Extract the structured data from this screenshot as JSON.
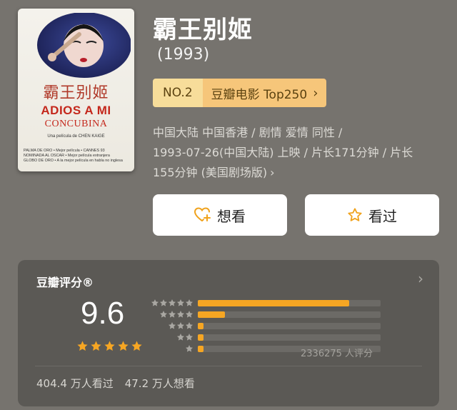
{
  "movie": {
    "title": "霸王别姬",
    "year": "(1993)",
    "rank_no": "NO.2",
    "rank_list": "豆瓣电影 Top250",
    "meta_line1": "中国大陆 中国香港 / 剧情 爱情 同性 /",
    "meta_line2": "1993-07-26(中国大陆) 上映 / 片长171分钟 / 片长",
    "meta_line3": "155分钟 (美国剧场版)"
  },
  "poster": {
    "cn_title": "霸王别姬",
    "en_title_1": "ADIOS A MI",
    "en_title_2": "CONCUBINA",
    "byline": "Una película de CHEN KAIGE",
    "credits_1": "PALMA DE ORO • Mejor película • CANNES 93",
    "credits_2": "NOMINADA AL OSCAR • Mejor película extranjera",
    "credits_3": "GLOBO DE ORO • A la mejor película en habla no inglesa"
  },
  "actions": {
    "want_label": "想看",
    "seen_label": "看过"
  },
  "rating": {
    "section_title": "豆瓣评分®",
    "score": "9.6",
    "score_stars": 5,
    "distribution": [
      {
        "stars": 5,
        "fraction": 0.83
      },
      {
        "stars": 4,
        "fraction": 0.15
      },
      {
        "stars": 3,
        "fraction": 0.02
      },
      {
        "stars": 2,
        "fraction": 0.01
      },
      {
        "stars": 1,
        "fraction": 0.01
      }
    ],
    "count_text": "2336275 人评分",
    "watched_text": "404.4 万人看过",
    "want_text": "47.2 万人想看"
  },
  "colors": {
    "accent_star": "#f6a623",
    "badge_light": "#f7dd9a",
    "badge_dark": "#f6c67a"
  }
}
